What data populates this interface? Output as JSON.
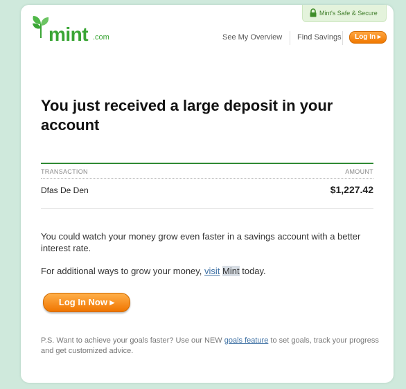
{
  "header": {
    "logo_text": "mint",
    "logo_suffix": ".com",
    "safe_badge": "Mint's Safe & Secure",
    "nav_overview": "See My Overview",
    "nav_savings": "Find Savings",
    "login_small": "Log In ▸"
  },
  "headline": "You just received a large deposit in your account",
  "table": {
    "col_transaction": "TRANSACTION",
    "col_amount": "AMOUNT",
    "rows": [
      {
        "name": "Dfas De Den",
        "amount": "$1,227.42"
      }
    ]
  },
  "body": {
    "p1": "You could watch your money grow even faster in a savings account with a better interest rate.",
    "p2_pre": "For additional ways to grow your money, ",
    "p2_link": "visit",
    "p2_mint": "Mint",
    "p2_post": " today."
  },
  "login_big": "Log In  Now ▸",
  "ps": {
    "pre": "P.S. Want to achieve your goals faster? Use our NEW ",
    "link": "goals feature",
    "post": " to set goals, track your progress and get customized advice."
  },
  "colors": {
    "brand_green": "#3aa535",
    "accent_orange": "#f07800",
    "background": "#cfe9dc"
  }
}
